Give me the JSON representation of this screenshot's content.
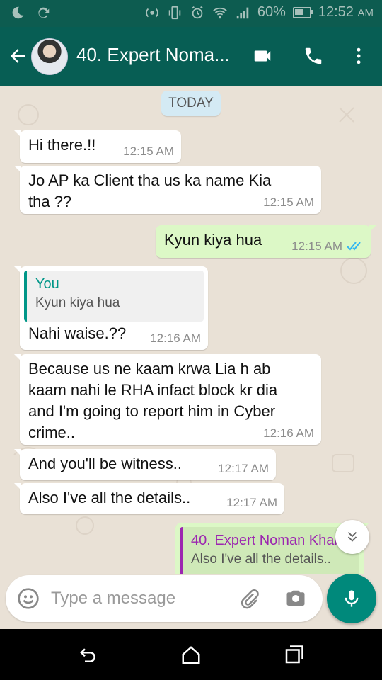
{
  "status_bar": {
    "battery": "60%",
    "time": "12:52",
    "ampm": "AM",
    "battery_level": 0.6
  },
  "header": {
    "title": "40. Expert Noma...",
    "icons": [
      "back-arrow-icon",
      "video-call-icon",
      "phone-icon",
      "more-vert-icon"
    ]
  },
  "chat": {
    "date_label": "TODAY",
    "messages": [
      {
        "dir": "in",
        "lines": [
          "Hi there.!!"
        ],
        "time": "12:15 AM"
      },
      {
        "dir": "in",
        "lines": [
          "Jo AP ka Client tha us ka name Kia",
          "tha ??"
        ],
        "time": "12:15 AM"
      },
      {
        "dir": "out",
        "lines": [
          "Kyun kiya hua"
        ],
        "time": "12:15 AM",
        "read": "double-check-icon"
      },
      {
        "dir": "in",
        "quote_author": "You",
        "quote_text": "Kyun kiya hua",
        "lines": [
          "Nahi waise.??"
        ],
        "time": "12:16 AM"
      },
      {
        "dir": "in",
        "lines": [
          "Because us ne kaam krwa Lia h ab",
          "kaam nahi le RHA infact block kr dia",
          "and I'm going to report him in Cyber",
          "crime.."
        ],
        "time": "12:16 AM"
      },
      {
        "dir": "in",
        "lines": [
          "And you'll be witness.."
        ],
        "time": "12:17 AM"
      },
      {
        "dir": "in",
        "lines": [
          "Also I've all the details.."
        ],
        "time": "12:17 AM"
      },
      {
        "dir": "out",
        "quote_author": "40. Expert Noman Khan",
        "quote_text": "Also I've all the details.."
      }
    ]
  },
  "composer": {
    "placeholder": "Type a message"
  },
  "colors": {
    "header": "#075e54",
    "status": "#0d5c50",
    "outgoing": "#dcf8c6",
    "incoming": "#ffffff",
    "accent": "#00897b",
    "read_tick": "#34b7f1"
  }
}
